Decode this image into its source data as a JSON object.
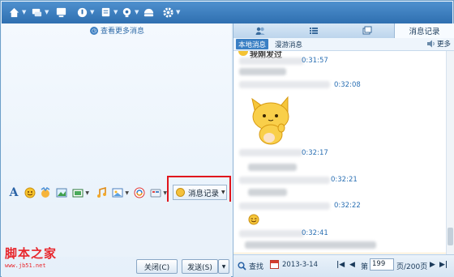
{
  "left_pane": {
    "view_more_label": "查看更多消息",
    "message_record_label": "消息记录",
    "close_label": "关闭(C)",
    "send_label": "发送(S)"
  },
  "watermark": {
    "title": "脚本之家",
    "url": "www.jb51.net"
  },
  "right_pane": {
    "tab_history": "消息记录",
    "local_label": "本地消息",
    "roaming_label": "漫游消息",
    "more_label": "更多",
    "top_partial_text": "我刚发过",
    "messages": [
      {
        "time": "0:31:57"
      },
      {
        "time": "0:32:08"
      },
      {
        "time": "0:32:17"
      },
      {
        "time": "0:32:21"
      },
      {
        "time": "0:32:22"
      },
      {
        "time": "0:32:41"
      }
    ],
    "footer": {
      "search_label": "查找",
      "date": "2013-3-14",
      "page_prefix": "第",
      "page_value": "199",
      "page_suffix": "页/200页"
    }
  },
  "colors": {
    "accent": "#2f6fb0",
    "highlight_box": "#e0141c",
    "time_text": "#2a6fb3",
    "selected_row": "#fbe9c7"
  }
}
